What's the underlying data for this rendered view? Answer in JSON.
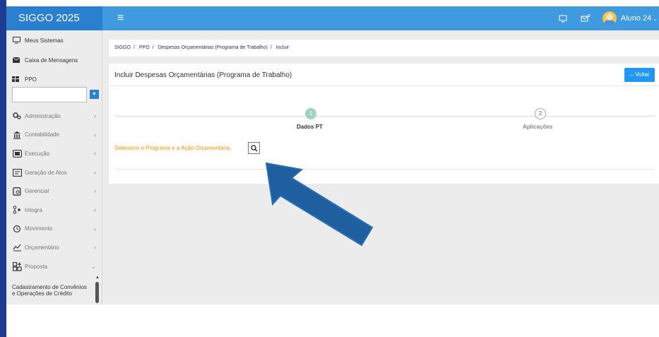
{
  "app": {
    "title": "SIGGO 2025"
  },
  "topbar": {
    "menu_icon": "hamburger-icon",
    "user_name": "Aluno 24"
  },
  "sidebar": {
    "top_items": [
      {
        "label": "Meus Sistemas",
        "icon": "monitor-icon"
      },
      {
        "label": "Caixa de Mensagens",
        "icon": "envelope-icon"
      }
    ],
    "module_label": "PPO",
    "items": [
      {
        "label": "Administração",
        "icon": "gears-icon"
      },
      {
        "label": "Contabilidade",
        "icon": "bank-icon"
      },
      {
        "label": "Execução",
        "icon": "cash-icon"
      },
      {
        "label": "Geração de Atos",
        "icon": "document-icon"
      },
      {
        "label": "Gerencial",
        "icon": "report-icon"
      },
      {
        "label": "Integra",
        "icon": "integration-icon"
      },
      {
        "label": "Movimento",
        "icon": "history-icon"
      },
      {
        "label": "Orçamentário",
        "icon": "chart-icon"
      },
      {
        "label": "Proposta",
        "icon": "grid-plus-icon"
      }
    ],
    "subitem": "Cadastramento de Convênios e Operações de Crédito"
  },
  "breadcrumb": [
    "SIGGO",
    "PPO",
    "Despesas Orçamentárias (Programa de Trabalho)",
    "Incluir"
  ],
  "panel": {
    "title": "Incluir Despesas Orçamentárias (Programa de Trabalho)",
    "back_label": "Voltar",
    "steps": [
      {
        "number": "1",
        "label": "Dados PT"
      },
      {
        "number": "2",
        "label": "Aplicações"
      }
    ],
    "prompt": "Selecione o Programa e a Ação Orçamentária."
  },
  "colors": {
    "brand": "#2a7fcf",
    "topbar": "#3f9ae0",
    "warning_text": "#e8960c",
    "arrow": "#1f5fa0"
  }
}
